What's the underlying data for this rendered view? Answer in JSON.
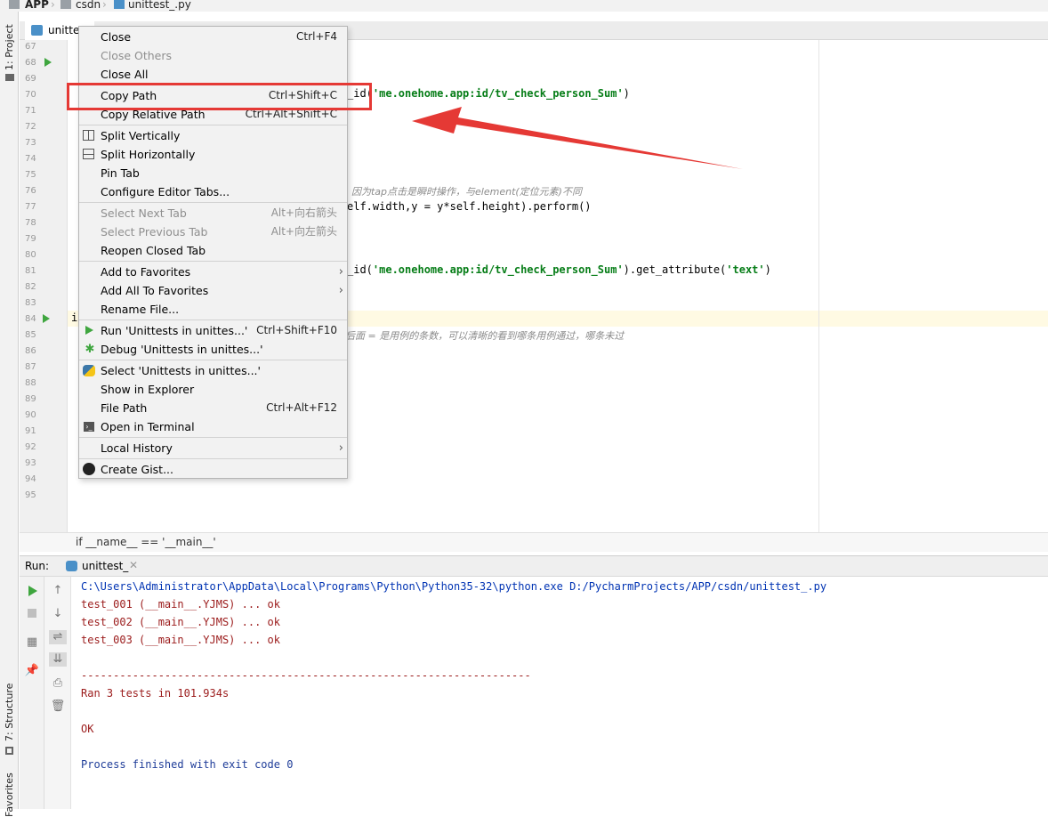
{
  "breadcrumb": {
    "items": [
      "APP",
      "csdn",
      "unittest_.py"
    ]
  },
  "left_strip": {
    "project": "1: Project",
    "structure": "7: Structure",
    "favorites": "Favorites"
  },
  "editor_tab": {
    "label": "unittest"
  },
  "line_numbers": [
    "67",
    "68",
    "69",
    "70",
    "71",
    "72",
    "73",
    "74",
    "75",
    "76",
    "77",
    "78",
    "79",
    "80",
    "81",
    "82",
    "83",
    "84",
    "85",
    "86",
    "87",
    "88",
    "89",
    "90",
    "91",
    "92",
    "93",
    "94",
    "95"
  ],
  "code": {
    "line70_a": "_id(",
    "line70_str": "'me.onehome.app:id/tv_check_person_Sum'",
    "line70_b": ")",
    "line76_comment": ", 因为tap点击是瞬时操作，与element(定位元素)不同",
    "line77": "elf.width,y = y*self.height).perform()",
    "line81_a": "_id(",
    "line81_str": "'me.onehome.app:id/tv_check_person_Sum'",
    "line81_b": ").get_attribute(",
    "line81_str2": "'text'",
    "line81_c": ")",
    "line84": "i",
    "line85_comment": "后面 = 是用例的条数，可以清晰的看到哪条用例通过，哪条未过"
  },
  "editor_breadcrumb": {
    "text": "if __name__ == '__main__'"
  },
  "run": {
    "label": "Run:",
    "tab": "unittest_",
    "console": [
      "C:\\Users\\Administrator\\AppData\\Local\\Programs\\Python\\Python35-32\\python.exe D:/PycharmProjects/APP/csdn/unittest_.py",
      "test_001 (__main__.YJMS) ... ok",
      "test_002 (__main__.YJMS) ... ok",
      "test_003 (__main__.YJMS) ... ok",
      "----------------------------------------------------------------------",
      "Ran 3 tests in 101.934s",
      "OK",
      "Process finished with exit code 0"
    ]
  },
  "context_menu": {
    "items": [
      {
        "label": "Close",
        "shortcut": "Ctrl+F4"
      },
      {
        "label": "Close Others"
      },
      {
        "label": "Close All"
      },
      {
        "label": "Copy Path",
        "shortcut": "Ctrl+Shift+C"
      },
      {
        "label": "Copy Relative Path",
        "shortcut": "Ctrl+Alt+Shift+C"
      },
      {
        "label": "Split Vertically"
      },
      {
        "label": "Split Horizontally"
      },
      {
        "label": "Pin Tab"
      },
      {
        "label": "Configure Editor Tabs..."
      },
      {
        "label": "Select Next Tab",
        "shortcut": "Alt+向右箭头"
      },
      {
        "label": "Select Previous Tab",
        "shortcut": "Alt+向左箭头"
      },
      {
        "label": "Reopen Closed Tab"
      },
      {
        "label": "Add to Favorites"
      },
      {
        "label": "Add All To Favorites"
      },
      {
        "label": "Rename File..."
      },
      {
        "label": "Run 'Unittests in unittes...'",
        "shortcut": "Ctrl+Shift+F10"
      },
      {
        "label": "Debug 'Unittests in unittes...'"
      },
      {
        "label": "Select 'Unittests in unittes...'"
      },
      {
        "label": "Show in Explorer"
      },
      {
        "label": "File Path",
        "shortcut": "Ctrl+Alt+F12"
      },
      {
        "label": "Open in Terminal"
      },
      {
        "label": "Local History"
      },
      {
        "label": "Create Gist..."
      }
    ]
  },
  "colors": {
    "highlight": "#e53935",
    "arrow": "#e53935"
  },
  "icons": [
    "folder-icon",
    "python-file-icon",
    "run-icon",
    "debug-icon",
    "python-icon",
    "terminal-icon",
    "github-icon",
    "split-vertical-icon",
    "split-horizontal-icon",
    "pin-icon",
    "trash-icon",
    "print-icon"
  ]
}
